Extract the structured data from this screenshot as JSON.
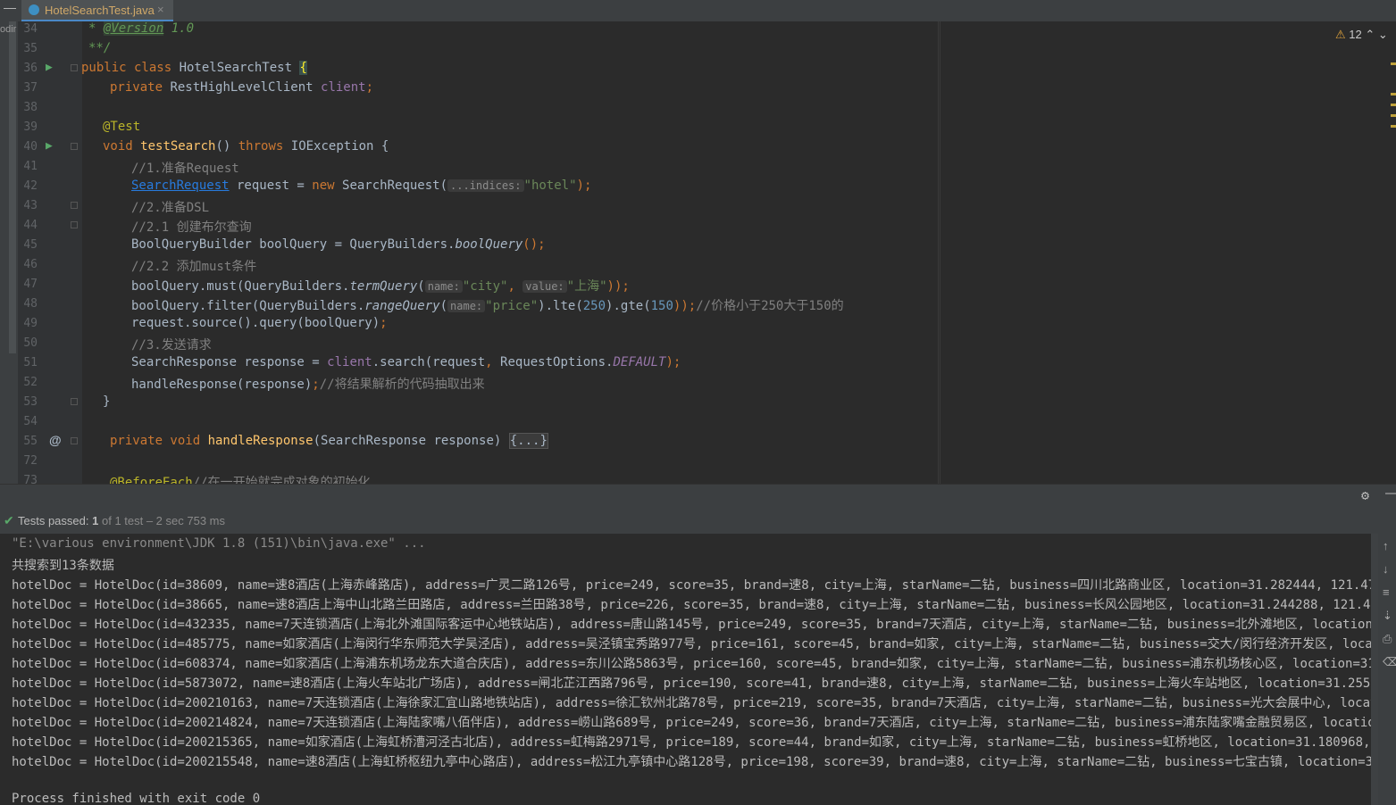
{
  "tab": {
    "filename": "HotelSearchTest.java",
    "close": "×"
  },
  "left_strip_label": "odir",
  "warnings": {
    "icon": "⚠",
    "count": "12"
  },
  "colors": {
    "accent": "#4a88c7",
    "success": "#59a869",
    "keyword": "#cc7832",
    "string": "#6a8759"
  },
  "test_status": {
    "label": "Tests passed:",
    "count": "1",
    "detail": "of 1 test – 2 sec 753 ms"
  },
  "console": [
    "\"E:\\various environment\\JDK 1.8 (151)\\bin\\java.exe\" ...",
    "共搜索到13条数据",
    "hotelDoc = HotelDoc(id=38609, name=速8酒店(上海赤峰路店), address=广灵二路126号, price=249, score=35, brand=速8, city=上海, starName=二钻, business=四川北路商业区, location=31.282444, 121.479385, pi",
    "hotelDoc = HotelDoc(id=38665, name=速8酒店上海中山北路兰田路店, address=兰田路38号, price=226, score=35, brand=速8, city=上海, starName=二钻, business=长风公园地区, location=31.244288, 121.422419, p",
    "hotelDoc = HotelDoc(id=432335, name=7天连锁酒店(上海北外滩国际客运中心地铁站店), address=唐山路145号, price=249, score=35, brand=7天酒店, city=上海, starName=二钻, business=北外滩地区, location=31.252",
    "hotelDoc = HotelDoc(id=485775, name=如家酒店(上海闵行华东师范大学吴泾店), address=吴泾镇宝秀路977号, price=161, score=45, brand=如家, city=上海, starName=二钻, business=交大/闵行经济开发区, location=31",
    "hotelDoc = HotelDoc(id=608374, name=如家酒店(上海浦东机场龙东大道合庆店), address=东川公路5863号, price=160, score=45, brand=如家, city=上海, starName=二钻, business=浦东机场核心区, location=31.237662",
    "hotelDoc = HotelDoc(id=5873072, name=速8酒店(上海火车站北广场店), address=闸北芷江西路796号, price=190, score=41, brand=速8, city=上海, starName=二钻, business=上海火车站地区, location=31.255579, 12",
    "hotelDoc = HotelDoc(id=200210163, name=7天连锁酒店(上海徐家汇宜山路地铁站店), address=徐汇钦州北路78号, price=219, score=35, brand=7天酒店, city=上海, starName=二钻, business=光大会展中心, location=31.",
    "hotelDoc = HotelDoc(id=200214824, name=7天连锁酒店(上海陆家嘴八佰伴店), address=崂山路689号, price=249, score=36, brand=7天酒店, city=上海, starName=二钻, business=浦东陆家嘴金融贸易区, location=31.22",
    "hotelDoc = HotelDoc(id=200215365, name=如家酒店(上海虹桥漕河泾古北店), address=虹梅路2971号, price=189, score=44, brand=如家, city=上海, starName=二钻, business=虹桥地区, location=31.180968, 121.392",
    "hotelDoc = HotelDoc(id=200215548, name=速8酒店(上海虹桥枢纽九亭中心路店), address=松江九亭镇中心路128号, price=198, score=39, brand=速8, city=上海, starName=二钻, business=七宝古镇, location=31.1193",
    "",
    "Process finished with exit code 0"
  ],
  "code_lines": {
    "l34": {
      "ln": "34",
      "a": "* ",
      "b": "@Version",
      "c": " 1.0"
    },
    "l35": {
      "ln": "35",
      "a": "**/"
    },
    "l36": {
      "ln": "36",
      "a": "public class ",
      "b": "HotelSearchTest ",
      "c": "{"
    },
    "l37": {
      "ln": "37",
      "a": "private ",
      "b": "RestHighLevelClient ",
      "c": "client",
      "d": ";"
    },
    "l38": {
      "ln": "38"
    },
    "l39": {
      "ln": "39",
      "a": "@Test"
    },
    "l40": {
      "ln": "40",
      "a": "void ",
      "b": "testSearch",
      "c": "() ",
      "d": "throws ",
      "e": "IOException {"
    },
    "l41": {
      "ln": "41",
      "a": "//1.准备Request"
    },
    "l42": {
      "ln": "42",
      "a": "SearchRequest",
      "b": " request = ",
      "c": "new ",
      "d": "SearchRequest(",
      "e": "...indices:",
      "f": "\"hotel\"",
      "g": ");"
    },
    "l43": {
      "ln": "43",
      "a": "//2.准备DSL"
    },
    "l44": {
      "ln": "44",
      "a": "//2.1 创建布尔查询"
    },
    "l45": {
      "ln": "45",
      "a": "BoolQueryBuilder boolQuery = QueryBuilders.",
      "b": "boolQuery",
      "c": "();"
    },
    "l46": {
      "ln": "46",
      "a": "//2.2 添加must条件"
    },
    "l47": {
      "ln": "47",
      "a": "boolQuery.must(QueryBuilders.",
      "b": "termQuery",
      "c": "(",
      "d": "name:",
      "e": "\"city\"",
      "f": ", ",
      "g": "value:",
      "h": "\"上海\"",
      "i": "));"
    },
    "l48": {
      "ln": "48",
      "a": "boolQuery.filter(QueryBuilders.",
      "b": "rangeQuery",
      "c": "(",
      "d": "name:",
      "e": "\"price\"",
      "f": ").lte(",
      "g": "250",
      "h": ").gte(",
      "i": "150",
      "j": "));",
      "k": "//价格小于250大于150的"
    },
    "l49": {
      "ln": "49",
      "a": "request.source().query(boolQuery)",
      "b": ";"
    },
    "l50": {
      "ln": "50",
      "a": "//3.发送请求"
    },
    "l51": {
      "ln": "51",
      "a": "SearchResponse response = ",
      "b": "client",
      "c": ".search(request",
      "d": ", ",
      "e": "RequestOptions.",
      "f": "DEFAULT",
      "g": ");"
    },
    "l52": {
      "ln": "52",
      "a": "handleResponse(response)",
      "b": ";",
      "c": "//将结果解析的代码抽取出来"
    },
    "l53": {
      "ln": "53",
      "a": "}"
    },
    "l54": {
      "ln": "54"
    },
    "l55": {
      "ln": "55",
      "a": "private void ",
      "b": "handleResponse",
      "c": "(SearchResponse response) ",
      "d": "{...}"
    },
    "l72": {
      "ln": "72"
    },
    "l73": {
      "ln": "73",
      "a": "@BeforeEach",
      "b": "//在一开始就完成对象的初始化"
    }
  }
}
